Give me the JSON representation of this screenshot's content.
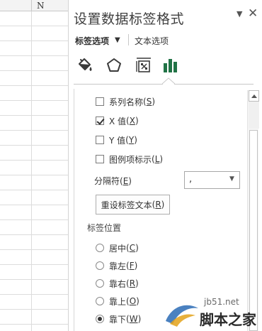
{
  "sheet": {
    "column_letter": "N"
  },
  "pane": {
    "title": "设置数据标签格式",
    "dropdown_icon": "chevron-down-icon",
    "close_icon": "close-icon"
  },
  "tabs": {
    "label_options": "标签选项",
    "text_options": "文本选项"
  },
  "category_icons": [
    "fill-line-icon",
    "effects-pentagon-icon",
    "size-properties-icon",
    "bar-chart-options-icon"
  ],
  "checkboxes": [
    {
      "label": "系列名称",
      "key": "S",
      "checked": false
    },
    {
      "label": "X 值",
      "key": "X",
      "checked": true
    },
    {
      "label": "Y 值",
      "key": "Y",
      "checked": false
    },
    {
      "label": "图例项标示",
      "key": "L",
      "checked": false
    }
  ],
  "separator": {
    "label": "分隔符",
    "key": "E",
    "value": ","
  },
  "reset_button": {
    "label": "重设标签文本",
    "key": "R"
  },
  "position": {
    "heading": "标签位置",
    "options": [
      {
        "label": "居中",
        "key": "C",
        "selected": false
      },
      {
        "label": "靠左",
        "key": "F",
        "selected": false
      },
      {
        "label": "靠右",
        "key": "R",
        "selected": false
      },
      {
        "label": "靠上",
        "key": "O",
        "selected": false
      },
      {
        "label": "靠下",
        "key": "W",
        "selected": true
      }
    ]
  },
  "watermark": {
    "site": "jb51.net",
    "name": "脚本之家"
  },
  "colors": {
    "accent_green": "#217346",
    "title_gray": "#404040"
  }
}
